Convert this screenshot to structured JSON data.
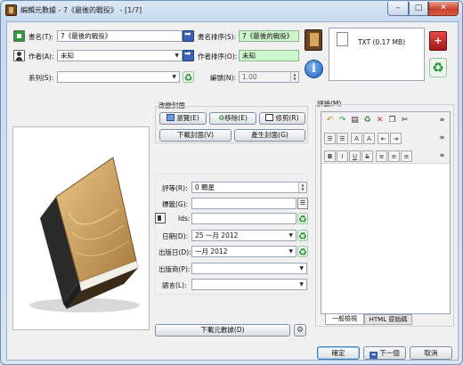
{
  "window": {
    "title": "編輯元數據 - 7《最後的戰役》 - [1/7]"
  },
  "fields": {
    "title": {
      "label": "書名(T):",
      "value": "7《最後的戰役》"
    },
    "title_sort": {
      "label": "書名排序(S):",
      "value": "7《最後的戰役》"
    },
    "authors": {
      "label": "作者(A):",
      "value": "未知"
    },
    "author_sort": {
      "label": "作者排序(O):",
      "value": "未知"
    },
    "series": {
      "label": "系列(S):",
      "value": ""
    },
    "series_index": {
      "label": "編號(N):",
      "value": "1.00"
    },
    "rating": {
      "label": "評等(R):",
      "value": "0 顆星"
    },
    "tags": {
      "label": "標籤(G):",
      "value": ""
    },
    "ids": {
      "label": "Ids:",
      "value": ""
    },
    "date": {
      "label": "日期(D):",
      "value": "25 一月 2012"
    },
    "pubdate": {
      "label": "出版日(D):",
      "value": "一月 2012"
    },
    "publisher": {
      "label": "出版商(P):",
      "value": ""
    },
    "languages": {
      "label": "語言(L):",
      "value": ""
    }
  },
  "formats": {
    "items": [
      "TXT (0.17 MB)"
    ]
  },
  "cover": {
    "group_label": "改變封面",
    "browse": "瀏覽(E)",
    "remove": "移除(E)",
    "trim": "修剪(R)",
    "download": "下載封面(V)",
    "generate": "產生封面(G)"
  },
  "comments": {
    "label": "評論(M)",
    "tab_normal": "一般檢視",
    "tab_html": "HTML 原始碼",
    "toolbar_row2": [
      "☰",
      "☰",
      "A",
      "A",
      "⇤",
      "⇥"
    ],
    "toolbar_row3": [
      "B",
      "I",
      "U",
      "S",
      "≡",
      "≡",
      "≡"
    ]
  },
  "buttons": {
    "download_metadata": "下載元數據(D)",
    "ok": "確定",
    "next": "下一個",
    "cancel": "取消"
  },
  "window_controls": {
    "minimize": "–",
    "maximize": "□",
    "close": "✕"
  },
  "colors": {
    "green_field": "#ccf5cc",
    "action_blue": "#3a62b4",
    "delete_red": "#c0392b"
  }
}
